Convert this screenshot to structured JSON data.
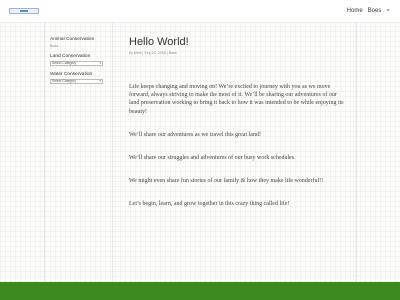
{
  "header": {
    "nav": [
      {
        "label": "Home"
      },
      {
        "label": "Boes"
      }
    ],
    "search_icon": "⌕"
  },
  "sidebar": {
    "widgets": [
      {
        "title": "Animal Conservation",
        "text": "Boes"
      },
      {
        "title": "Land Conservation",
        "select": "Select Category"
      },
      {
        "title": "Water Conservation",
        "select": "Select Category"
      }
    ]
  },
  "post": {
    "title": "Hello World!",
    "meta": "by Mimi | Sep 20, 2018 | Boes",
    "paragraphs": [
      "Life keeps changing and moving on!   We’re excited to journey with you as we move forward, always striving to make the most of it.  We’ll be sharing our adventures of our land preservation working to bring it back to how it was intended to be while enjoying its beauty!",
      "We’ll share our adventures as we travel this great land!",
      "We’ll share our struggles and adventures of our busy work schedules.",
      "We might even share fun stories of our family & how they make life wonderful!!",
      "Let’s begin, learn, and grow together in this crazy thing called life!"
    ]
  },
  "colors": {
    "footer": "#3d8a1f",
    "logo_accent": "#5c8bc4"
  }
}
